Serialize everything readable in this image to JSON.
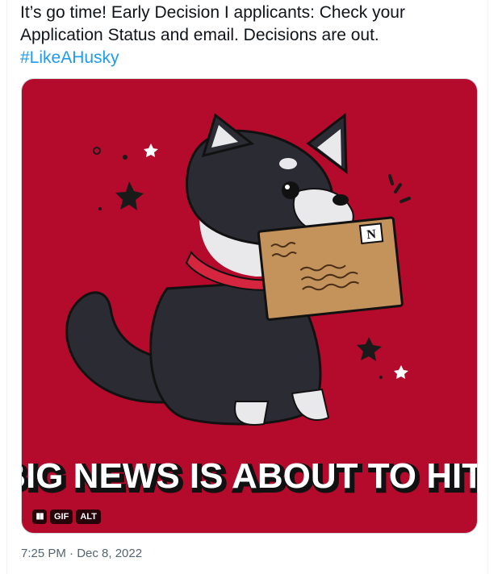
{
  "tweet": {
    "text": "It’s go time! Early Decision I applicants: Check your Application Status and email. Decisions are out.",
    "hashtag": "#LikeAHusky",
    "timestamp": "7:25 PM · Dec 8, 2022"
  },
  "media": {
    "caption": "BIG NEWS IS ABOUT TO HIT!",
    "envelope_logo": "N",
    "background_color": "#b40a2c",
    "pause_icon": "pause-icon",
    "gif_label": "GIF",
    "alt_label": "ALT"
  }
}
